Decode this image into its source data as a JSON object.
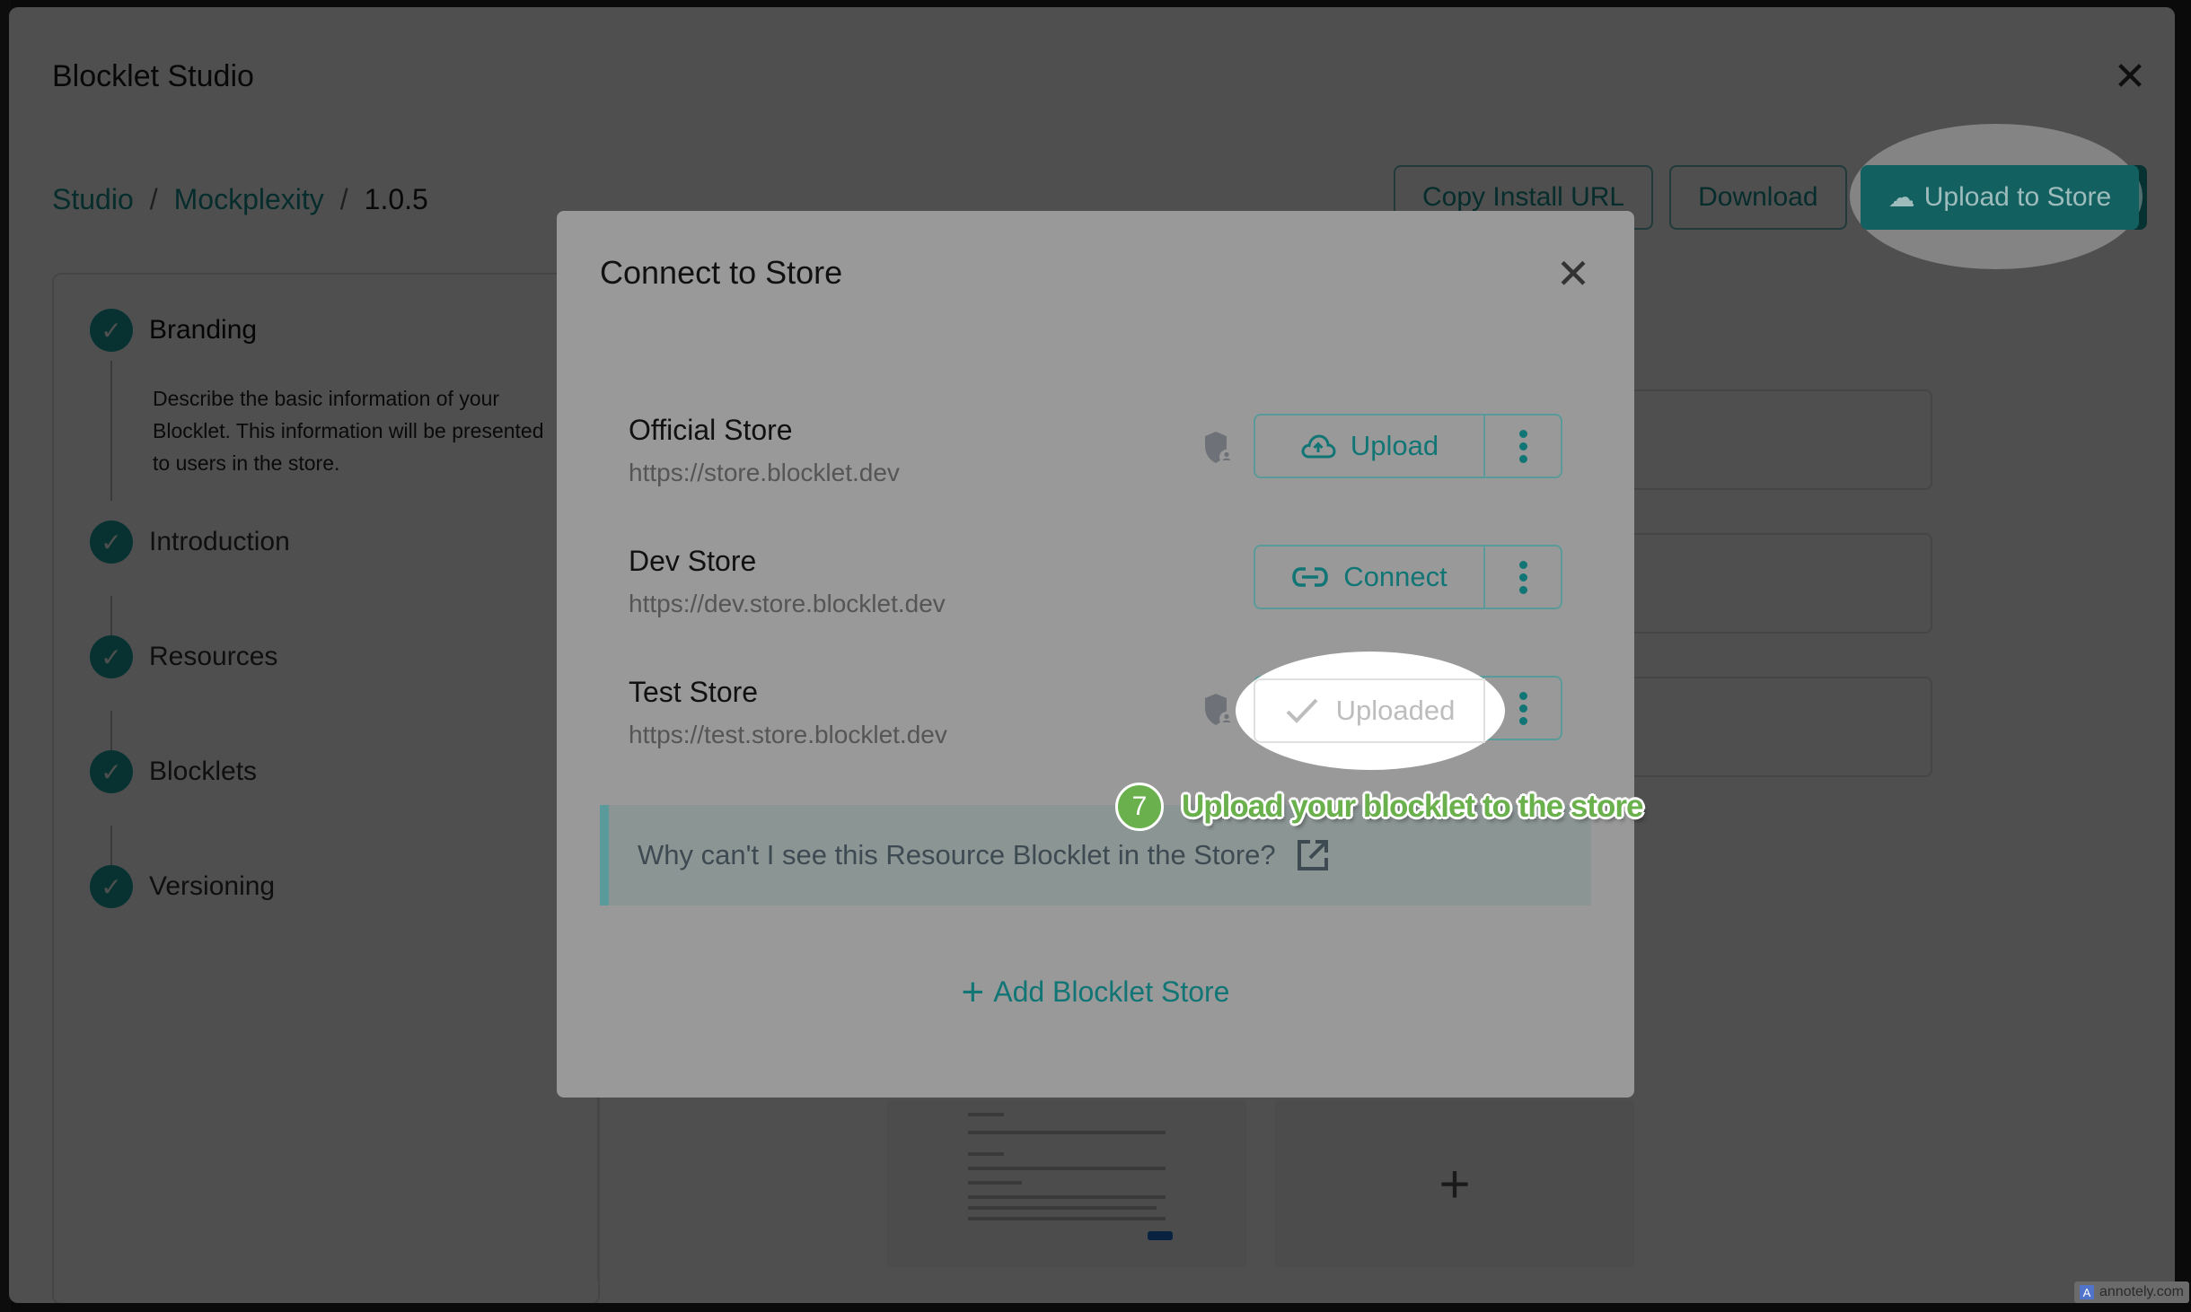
{
  "studio": {
    "title": "Blocklet Studio",
    "breadcrumb": [
      "Studio",
      "Mockplexity",
      "1.0.5"
    ],
    "breadcrumb_separator": "/",
    "actions": {
      "copy_install_url": "Copy Install URL",
      "download": "Download",
      "upload_to_store": "Upload to Store"
    },
    "steps": [
      {
        "label": "Branding",
        "description": "Describe the basic information of your Blocklet. This information will be presented to users in the store.",
        "completed": true
      },
      {
        "label": "Introduction",
        "completed": true
      },
      {
        "label": "Resources",
        "completed": true
      },
      {
        "label": "Blocklets",
        "completed": true
      },
      {
        "label": "Versioning",
        "completed": true
      }
    ],
    "add_tile_symbol": "+"
  },
  "modal": {
    "title": "Connect to Store",
    "stores": [
      {
        "name": "Official Store",
        "url": "https://store.blocklet.dev",
        "action": "Upload",
        "action_icon": "cloud-upload-icon",
        "has_shield": true,
        "state": "ready"
      },
      {
        "name": "Dev Store",
        "url": "https://dev.store.blocklet.dev",
        "action": "Connect",
        "action_icon": "link-icon",
        "has_shield": false,
        "state": "disconnected"
      },
      {
        "name": "Test Store",
        "url": "https://test.store.blocklet.dev",
        "action": "Uploaded",
        "action_icon": "check-icon",
        "has_shield": true,
        "state": "uploaded"
      }
    ],
    "info_text": "Why can't I see this Resource Blocklet in the Store?",
    "add_store_label": "Add Blocklet Store",
    "add_store_symbol": "+"
  },
  "annotation": {
    "step_number": "7",
    "text": "Upload your blocklet to the store"
  },
  "watermark": {
    "logo": "A",
    "text": "annotely.com"
  },
  "colors": {
    "accent": "#1aa3a3",
    "accent_dimmed": "#117575",
    "callout_green": "#6ab04c",
    "overlay": "#000000"
  }
}
